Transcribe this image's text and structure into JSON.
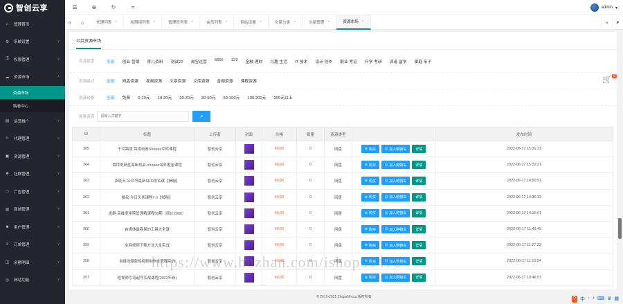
{
  "brand": {
    "name": "智创云享"
  },
  "sidebar": {
    "items": [
      {
        "label": "管理首页",
        "icon": "home-icon"
      },
      {
        "label": "系统设置",
        "icon": "gear-icon"
      },
      {
        "label": "权限管理",
        "icon": "lock-icon"
      },
      {
        "label": "资源市场",
        "icon": "cloud-icon"
      },
      {
        "label": "运营推广",
        "icon": "chart-icon"
      },
      {
        "label": "代理管理",
        "icon": "users-icon"
      },
      {
        "label": "资源管理",
        "icon": "folder-icon"
      },
      {
        "label": "社群管理",
        "icon": "group-icon"
      },
      {
        "label": "广告管理",
        "icon": "ad-icon"
      },
      {
        "label": "商城管理",
        "icon": "shop-icon"
      },
      {
        "label": "用户管理",
        "icon": "user-icon"
      },
      {
        "label": "订单管理",
        "icon": "order-icon"
      },
      {
        "label": "余额明细",
        "icon": "wallet-icon"
      },
      {
        "label": "网站功能",
        "icon": "globe-icon"
      }
    ],
    "subitems": [
      {
        "label": "资源市场"
      },
      {
        "label": "购卷中心"
      }
    ]
  },
  "topbar": {
    "user": "admin"
  },
  "tabs": [
    {
      "label": "代理列表"
    },
    {
      "label": "权限组列表"
    },
    {
      "label": "管理员列表"
    },
    {
      "label": "会员列表"
    },
    {
      "label": "网站设置"
    },
    {
      "label": "文章分类"
    },
    {
      "label": "文章管理"
    },
    {
      "label": "资源市场"
    }
  ],
  "panel": {
    "title": "公共资源市场"
  },
  "filters": {
    "category": {
      "label": "资源类型",
      "options": [
        "全部",
        "创业 营销",
        "育儿资料",
        "测试22",
        "淘宝运营",
        "6666",
        "123",
        "金融 理财",
        "兴趣 生活",
        "IT 技术",
        "设计 创作",
        "职业 考证",
        "升学 考研",
        "读者 留学",
        "家庭 亲子"
      ]
    },
    "format": {
      "label": "资源格式",
      "options": [
        "全部",
        "网盘资源",
        "视频资源",
        "文章资源",
        "文库资源",
        "音频资源",
        "课程资源"
      ]
    },
    "price": {
      "label": "资源价格",
      "options": [
        "全部",
        "免费",
        "0-10元",
        "10-20元",
        "20-30元",
        "30-50元",
        "50-100元",
        "100-200元",
        "200元以上"
      ]
    }
  },
  "search": {
    "label": "搜索资源",
    "placeholder": "请输入关键字"
  },
  "cart": {
    "count": "0"
  },
  "table": {
    "headers": [
      "ID",
      "标题",
      "上传者",
      "封面",
      "价格",
      "销量",
      "资源类型",
      "",
      "发布时间"
    ],
    "buttons": {
      "buy": "购买",
      "add_cart": "加入购物车",
      "detail": "详情"
    },
    "rows": [
      {
        "id": "365",
        "title": "千鸟跨境 跨境电商Shopee中阶课程",
        "uploader": "智创云享",
        "price": "¥0.00",
        "sales": "0",
        "type": "网盘",
        "time": "2022-06-17 15:31:21"
      },
      {
        "id": "364",
        "title": "跨境电商蓝海新机会-shopee海外掘金课程",
        "uploader": "智创云享",
        "price": "¥0.00",
        "sales": "0",
        "type": "网盘",
        "time": "2022-06-17 15:22:21"
      },
      {
        "id": "363",
        "title": "郭晓天·公众号最新SEO排名课【揭秘】",
        "uploader": "智创云享",
        "price": "¥0.00",
        "sales": "0",
        "type": "网盘",
        "time": "2022-06-17 14:50:51"
      },
      {
        "id": "362",
        "title": "猫叔·今日头条课程7.0【揭秘】",
        "uploader": "智创云享",
        "price": "¥0.00",
        "sales": "0",
        "type": "网盘",
        "time": "2022-06-17 14:36:32"
      },
      {
        "id": "361",
        "title": "孟群·高维度学院管理精课程58期（原价2980）",
        "uploader": "智创云享",
        "price": "¥0.00",
        "sales": "0",
        "type": "网盘",
        "time": "2022-06-17 14:16:01"
      },
      {
        "id": "360",
        "title": "自媒体最容易的工具大全课",
        "uploader": "智创云享",
        "price": "¥0.00",
        "sales": "0",
        "type": "网盘",
        "time": "2022-06-17 11:40:49"
      },
      {
        "id": "359",
        "title": "全网视频下载方法大全实战",
        "uploader": "智创云享",
        "price": "¥0.00",
        "sales": "0",
        "type": "网盘",
        "time": "2022-06-17 11:27:23"
      },
      {
        "id": "358",
        "title": "自媒体爆款短视频制作全流程实训",
        "uploader": "智创云享",
        "price": "¥0.00",
        "sales": "0",
        "type": "网盘",
        "time": "2022-06-17 11:10:54"
      },
      {
        "id": "357",
        "title": "短视频引流起号实战课程(2022年新)",
        "uploader": "智创云享",
        "price": "¥0.00",
        "sales": "0",
        "type": "网盘",
        "time": "2022-06-17 10:46:53"
      }
    ]
  },
  "footer": {
    "copyright": "© 2019-2021 ZhiqiaNhcca 版权所有"
  },
  "watermark": {
    "text": "https://www.huzhan.com/ishop31478"
  }
}
